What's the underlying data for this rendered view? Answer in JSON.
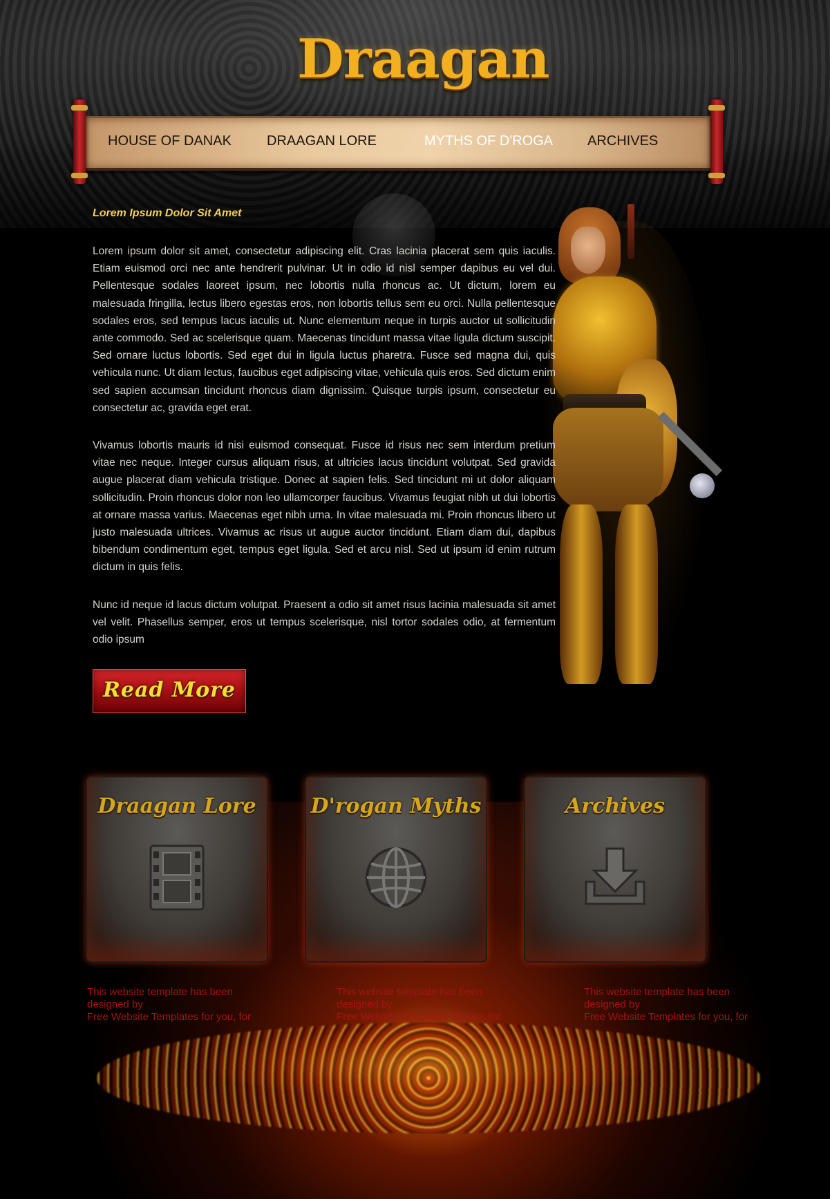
{
  "site": {
    "logo_text": "Draagan"
  },
  "nav": {
    "items": [
      {
        "label": "HOUSE OF DANAK"
      },
      {
        "label": "DRAAGAN LORE"
      },
      {
        "label": "MYTHS OF D'ROGA",
        "active": true
      },
      {
        "label": "ARCHIVES"
      }
    ]
  },
  "main": {
    "heading": "Lorem Ipsum Dolor Sit Amet",
    "paragraphs": [
      "Lorem ipsum dolor sit amet, consectetur adipiscing elit. Cras lacinia placerat sem quis iaculis. Etiam euismod orci nec ante hendrerit pulvinar. Ut in odio id nisl semper dapibus eu vel dui. Pellentesque sodales laoreet ipsum, nec lobortis nulla rhoncus ac. Ut dictum, lorem eu malesuada fringilla, lectus libero egestas eros, non lobortis tellus sem eu orci. Nulla pellentesque sodales eros, sed tempus lacus iaculis ut. Nunc elementum neque in turpis auctor ut sollicitudin ante commodo. Sed ac scelerisque quam. Maecenas tincidunt massa vitae ligula dictum suscipit. Sed ornare luctus lobortis. Sed eget dui in ligula luctus pharetra. Fusce sed magna dui, quis vehicula nunc. Ut diam lectus, faucibus eget adipiscing vitae, vehicula quis eros. Sed dictum enim sed sapien accumsan tincidunt rhoncus diam dignissim. Quisque turpis ipsum, consectetur eu consectetur ac, gravida eget erat.",
      "Vivamus lobortis mauris id nisi euismod consequat. Fusce id risus nec sem interdum pretium vitae nec neque. Integer cursus aliquam risus, at ultricies lacus tincidunt volutpat. Sed gravida augue placerat diam vehicula tristique. Donec at sapien felis. Sed tincidunt mi ut dolor aliquam sollicitudin. Proin rhoncus dolor non leo ullamcorper faucibus. Vivamus feugiat nibh ut dui lobortis at ornare massa varius. Maecenas eget nibh urna. In vitae malesuada mi. Proin rhoncus libero ut justo malesuada ultrices. Vivamus ac risus ut augue auctor tincidunt. Etiam diam dui, dapibus bibendum condimentum eget, tempus eget ligula. Sed et arcu nisl. Sed ut ipsum id enim rutrum dictum in quis felis.",
      "Nunc id neque id lacus dictum volutpat. Praesent a odio sit amet risus lacinia malesuada sit amet vel velit. Phasellus semper, eros ut tempus scelerisque, nisl tortor sodales odio, at fermentum odio ipsum"
    ],
    "read_more_label": "Read More"
  },
  "panels": [
    {
      "title": "Draagan Lore",
      "icon": "film-strip-icon"
    },
    {
      "title": "D'rogan Myths",
      "icon": "globe-icon"
    },
    {
      "title": "Archives",
      "icon": "download-icon"
    }
  ],
  "credits": [
    {
      "line1": "This website template has been",
      "line2": "designed by",
      "line3": "Free Website Templates for you, for"
    },
    {
      "line1": "This website template has been",
      "line2": "designed by",
      "line3": "Free Website Templates for you, for"
    },
    {
      "line1": "This website template has been",
      "line2": "designed by",
      "line3": "Free Website Templates for you, for"
    }
  ],
  "colors": {
    "heading": "#f4cf52",
    "body_text": "#d6d3cf",
    "credit_text": "#a31414",
    "nav_active": "#ffffff",
    "nav_text": "#1b130c",
    "accent_gold": "#d6a51c",
    "button_red": "#a10d10"
  }
}
